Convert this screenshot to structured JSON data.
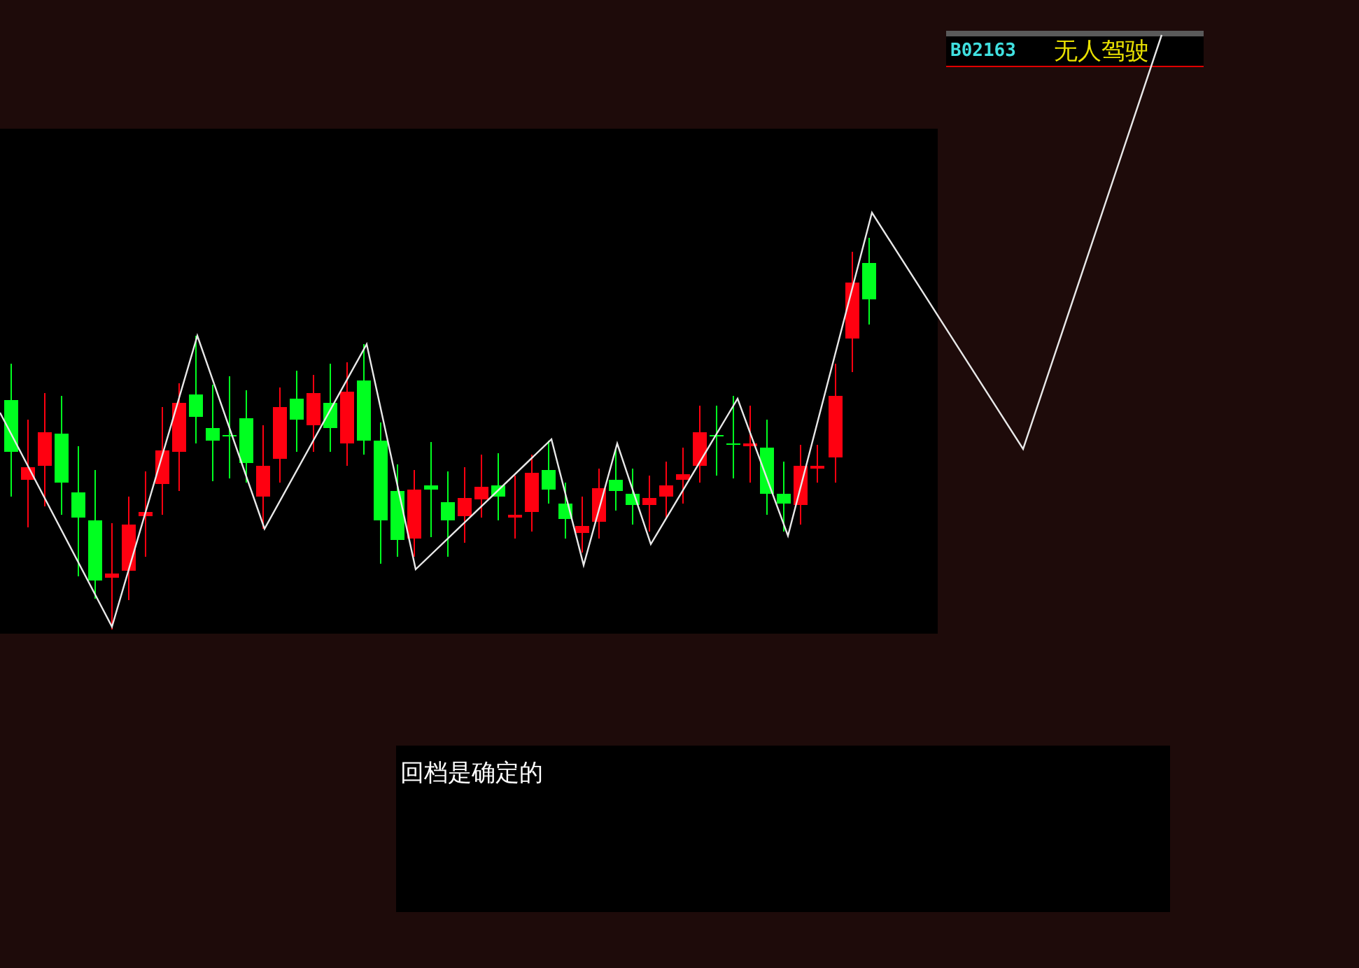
{
  "instrument": {
    "code": "B02163",
    "name": "无人驾驶"
  },
  "note": {
    "text": "回档是确定的"
  }
}
